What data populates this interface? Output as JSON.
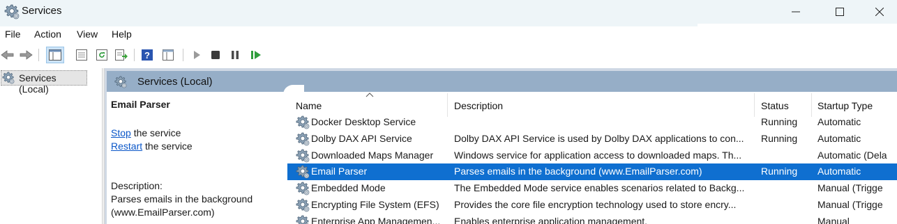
{
  "window": {
    "title": "Services",
    "icon": "gears-icon"
  },
  "menu": [
    "File",
    "Action",
    "View",
    "Help"
  ],
  "toolbar": {
    "buttons": [
      "back-icon",
      "forward-icon",
      "console-tree-icon",
      "properties-icon",
      "refresh-icon",
      "export-list-icon",
      "help-icon",
      "view-icon",
      "start-icon",
      "stop-icon",
      "pause-icon",
      "restart-icon"
    ]
  },
  "tree": {
    "root_label": "Services (Local)"
  },
  "pane": {
    "header": "Services (Local)"
  },
  "details": {
    "service_name": "Email Parser",
    "stop_link": "Stop",
    "stop_suffix": " the service",
    "restart_link": "Restart",
    "restart_suffix": " the service",
    "description_label": "Description:",
    "description_text": "Parses emails in the background (www.EmailParser.com)"
  },
  "list": {
    "columns": [
      "Name",
      "Description",
      "Status",
      "Startup Type"
    ],
    "rows": [
      {
        "name": "Docker Desktop Service",
        "description": "",
        "status": "Running",
        "startup": "Automatic",
        "selected": false
      },
      {
        "name": "Dolby DAX API Service",
        "description": "Dolby DAX API Service is used by Dolby DAX applications to con...",
        "status": "Running",
        "startup": "Automatic",
        "selected": false
      },
      {
        "name": "Downloaded Maps Manager",
        "description": "Windows service for application access to downloaded maps. Th...",
        "status": "",
        "startup": "Automatic (Dela",
        "selected": false
      },
      {
        "name": "Email Parser",
        "description": "Parses emails in the background (www.EmailParser.com)",
        "status": "Running",
        "startup": "Automatic",
        "selected": true
      },
      {
        "name": "Embedded Mode",
        "description": "The Embedded Mode service enables scenarios related to Backg...",
        "status": "",
        "startup": "Manual (Trigge",
        "selected": false
      },
      {
        "name": "Encrypting File System (EFS)",
        "description": "Provides the core file encryption technology used to store encry...",
        "status": "",
        "startup": "Manual (Trigge",
        "selected": false
      },
      {
        "name": "Enterprise App Managemen...",
        "description": "Enables enterprise application management.",
        "status": "",
        "startup": "Manual",
        "selected": false
      }
    ]
  },
  "colors": {
    "selection": "#0f6fd0",
    "pane_header": "#96aec7",
    "link": "#0a56c8",
    "titlebar": "#eef5f8"
  }
}
